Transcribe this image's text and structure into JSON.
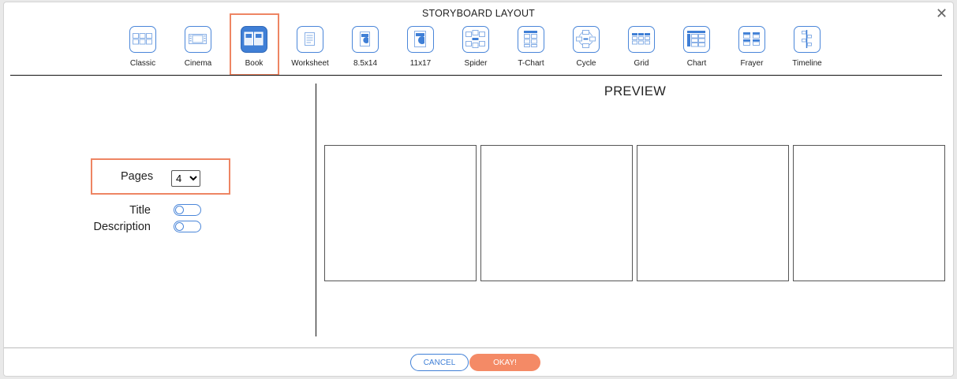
{
  "dialog": {
    "title": "STORYBOARD LAYOUT",
    "close_icon": "close-icon"
  },
  "layouts": [
    {
      "label": "Classic",
      "icon": "classic-layout-icon",
      "selected": false
    },
    {
      "label": "Cinema",
      "icon": "cinema-layout-icon",
      "selected": false
    },
    {
      "label": "Book",
      "icon": "book-layout-icon",
      "selected": true
    },
    {
      "label": "Worksheet",
      "icon": "worksheet-layout-icon",
      "selected": false
    },
    {
      "label": "8.5x14",
      "icon": "legal-layout-icon",
      "selected": false
    },
    {
      "label": "11x17",
      "icon": "tabloid-layout-icon",
      "selected": false
    },
    {
      "label": "Spider",
      "icon": "spider-layout-icon",
      "selected": false
    },
    {
      "label": "T-Chart",
      "icon": "tchart-layout-icon",
      "selected": false
    },
    {
      "label": "Cycle",
      "icon": "cycle-layout-icon",
      "selected": false
    },
    {
      "label": "Grid",
      "icon": "grid-layout-icon",
      "selected": false
    },
    {
      "label": "Chart",
      "icon": "chart-layout-icon",
      "selected": false
    },
    {
      "label": "Frayer",
      "icon": "frayer-layout-icon",
      "selected": false
    },
    {
      "label": "Timeline",
      "icon": "timeline-layout-icon",
      "selected": false
    }
  ],
  "options": {
    "pages_label": "Pages",
    "pages_value": "4",
    "title_label": "Title",
    "title_on": false,
    "description_label": "Description",
    "description_on": false
  },
  "preview": {
    "label": "PREVIEW",
    "page_count": 4
  },
  "footer": {
    "cancel_label": "CANCEL",
    "okay_label": "OKAY!"
  },
  "colors": {
    "accent": "#3f7fd6",
    "highlight": "#ee8563",
    "okay": "#f48a66"
  }
}
